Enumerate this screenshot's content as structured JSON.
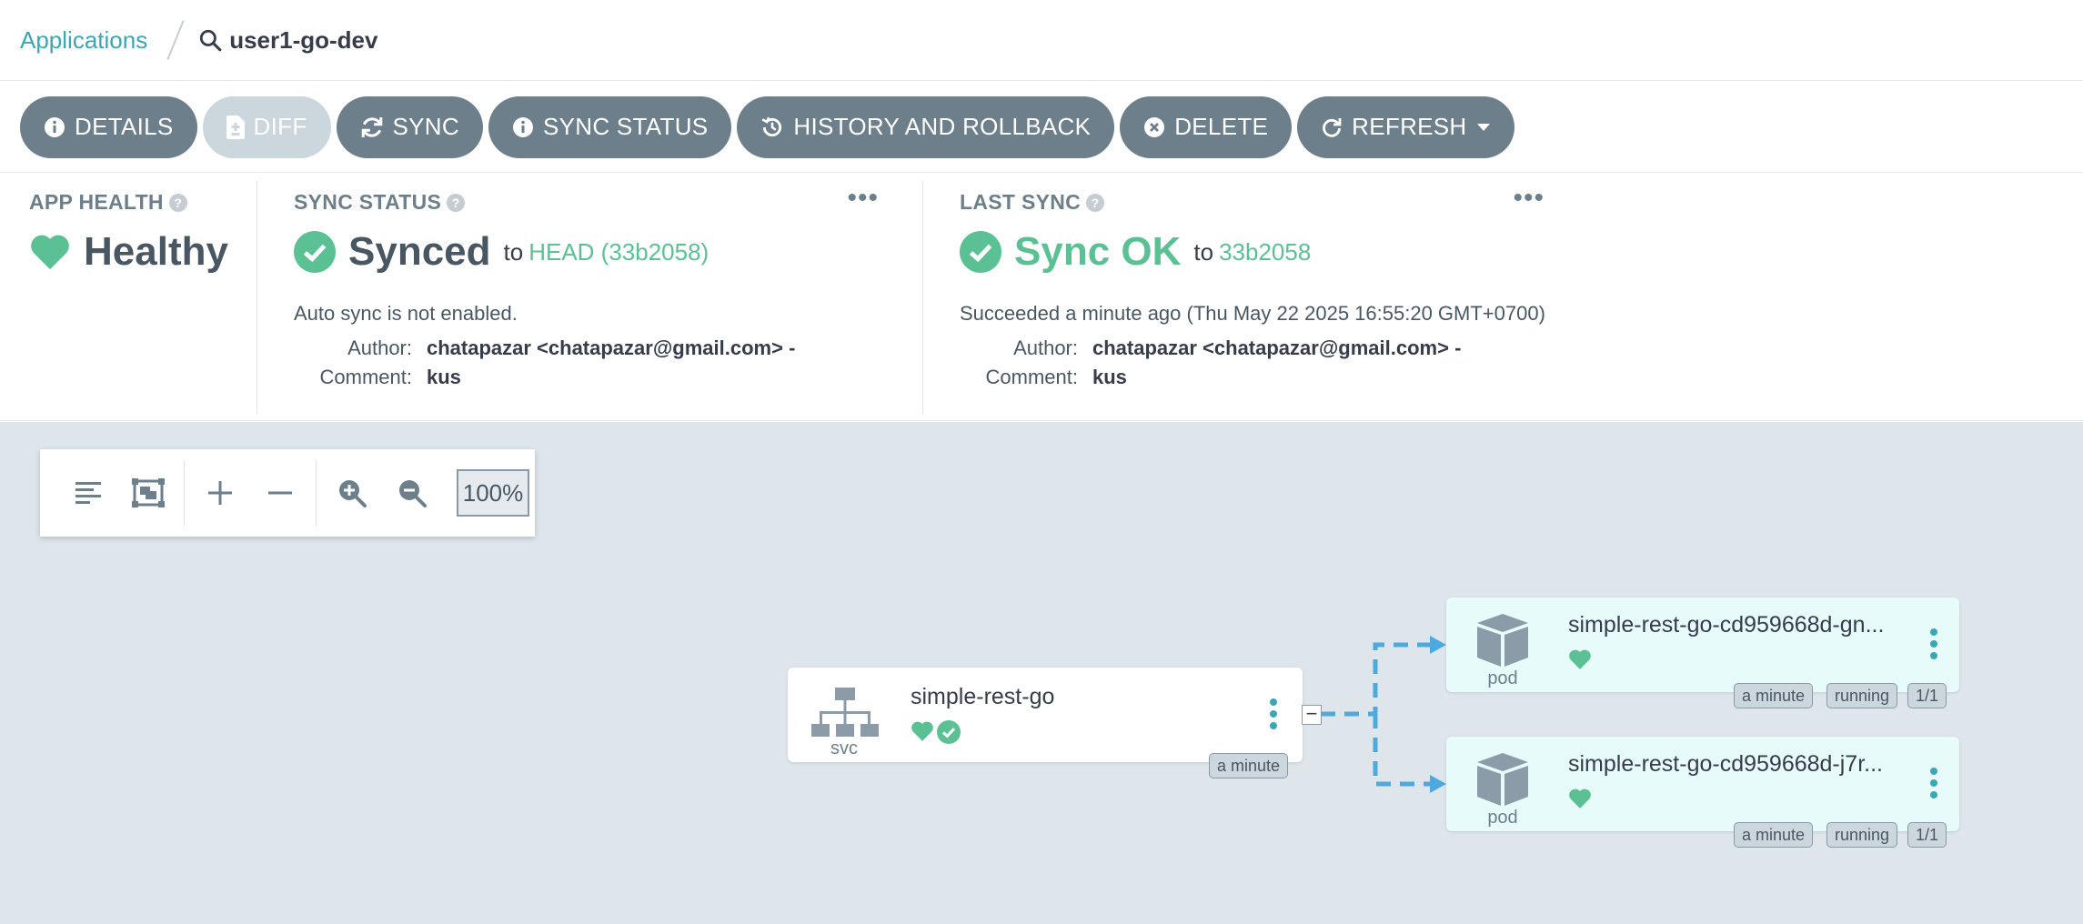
{
  "breadcrumb": {
    "parent": "Applications",
    "current": "user1-go-dev"
  },
  "actions": [
    {
      "label": "DETAILS",
      "icon": "info-icon"
    },
    {
      "label": "DIFF",
      "icon": "file-diff-icon",
      "disabled": true
    },
    {
      "label": "SYNC",
      "icon": "sync-icon"
    },
    {
      "label": "SYNC STATUS",
      "icon": "info-icon"
    },
    {
      "label": "HISTORY AND ROLLBACK",
      "icon": "history-icon"
    },
    {
      "label": "DELETE",
      "icon": "times-circle-icon"
    },
    {
      "label": "REFRESH",
      "icon": "redo-icon"
    }
  ],
  "app_health": {
    "title": "APP HEALTH",
    "status": "Healthy"
  },
  "sync_status": {
    "title": "SYNC STATUS",
    "status": "Synced",
    "to_prefix": "to",
    "revision": "HEAD (33b2058)",
    "note": "Auto sync is not enabled.",
    "author_label": "Author:",
    "author": "chatapazar <chatapazar@gmail.com> -",
    "comment_label": "Comment:",
    "comment": "kus"
  },
  "last_sync": {
    "title": "LAST SYNC",
    "status": "Sync OK",
    "to_prefix": "to",
    "revision": "33b2058",
    "note": "Succeeded a minute ago (Thu May 22 2025 16:55:20 GMT+0700)",
    "author_label": "Author:",
    "author": "chatapazar <chatapazar@gmail.com> -",
    "comment_label": "Comment:",
    "comment": "kus"
  },
  "graph_toolbar": {
    "zoom": "100%"
  },
  "graph": {
    "svc": {
      "name": "simple-rest-go",
      "kind": "svc",
      "age": "a minute"
    },
    "pods": [
      {
        "name": "simple-rest-go-cd959668d-gn...",
        "kind": "pod",
        "age": "a minute",
        "status": "running",
        "ready": "1/1"
      },
      {
        "name": "simple-rest-go-cd959668d-j7r...",
        "kind": "pod",
        "age": "a minute",
        "status": "running",
        "ready": "1/1"
      }
    ]
  },
  "colors": {
    "accent": "#3ba6b4",
    "healthy": "#5cc095",
    "button": "#6d7f8b",
    "edge": "#4ea9dc"
  }
}
